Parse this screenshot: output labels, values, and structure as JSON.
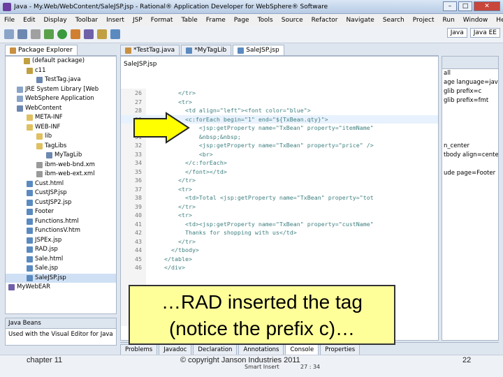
{
  "window": {
    "title": "Java - My.Web/WebContent/SaleJSP.jsp - Rational® Application Developer for WebSphere® Software"
  },
  "menu": [
    "File",
    "Edit",
    "Display",
    "Toolbar",
    "Insert",
    "JSP",
    "Format",
    "Table",
    "Frame",
    "Page",
    "Tools",
    "Source",
    "Refactor",
    "Navigate",
    "Search",
    "Project",
    "Run",
    "Window",
    "Help"
  ],
  "perspective": {
    "java": "Java",
    "javaee": "Java EE"
  },
  "explorer": {
    "tab": "Package Explorer",
    "items": [
      "(default package)",
      "c11",
      "TestTag.java",
      "JRE System Library [Web",
      "WebSphere Application",
      "WebContent",
      "META-INF",
      "WEB-INF",
      "lib",
      "TagLibs",
      "MyTagLib",
      "ibm-web-bnd.xm",
      "ibm-web-ext.xml",
      "Cust.html",
      "CustJSP.jsp",
      "CustJSP2.jsp",
      "Footer",
      "Functions.html",
      "FunctionsV.htm",
      "JSPEx.jsp",
      "RAD.jsp",
      "Sale.html",
      "Sale.jsp",
      "SaleJSP.jsp",
      "MyWebEAR"
    ]
  },
  "editor": {
    "tabs": [
      "*TestTag.java",
      "*MyTagLib",
      "SaleJSP.jsp"
    ],
    "crumb": "SaleJSP.jsp",
    "lines": [
      {
        "n": "26",
        "c": "        </tr>"
      },
      {
        "n": "27",
        "c": "        <tr>"
      },
      {
        "n": "28",
        "c": "          <td align=\"left\"><font color=\"blue\">"
      },
      {
        "n": "29",
        "c": "          <c:forEach begin=\"1\" end=\"${TxBean.qty}\">"
      },
      {
        "n": "30",
        "c": "              <jsp:getProperty name=\"TxBean\" property=\"itemName\""
      },
      {
        "n": "31",
        "c": "              &nbsp;&nbsp;"
      },
      {
        "n": "32",
        "c": "              <jsp:getProperty name=\"TxBean\" property=\"price\" />"
      },
      {
        "n": "33",
        "c": "              <br>"
      },
      {
        "n": "34",
        "c": "          </c:forEach>"
      },
      {
        "n": "35",
        "c": "          </font></td>"
      },
      {
        "n": "36",
        "c": "        </tr>"
      },
      {
        "n": "37",
        "c": "        <tr>"
      },
      {
        "n": "38",
        "c": "          <td>Total <jsp:getProperty name=\"TxBean\" property=\"tot"
      },
      {
        "n": "39",
        "c": "        </tr>"
      },
      {
        "n": "40",
        "c": "        <tr>"
      },
      {
        "n": "41",
        "c": "          <td><jsp:getProperty name=\"TxBean\" property=\"custName\""
      },
      {
        "n": "42",
        "c": "          Thanks for shopping with us</td>"
      },
      {
        "n": "43",
        "c": "        </tr>"
      },
      {
        "n": "44",
        "c": "      </tbody>"
      },
      {
        "n": "45",
        "c": "    </table>"
      },
      {
        "n": "46",
        "c": "    </div>"
      }
    ]
  },
  "outline": [
    "all",
    "age language=java",
    "glib prefix=c",
    "glib prefix=fmt",
    "",
    "",
    "",
    "",
    "n_center",
    "tbody align=cente",
    "",
    "ude page=Footer"
  ],
  "beans": {
    "tab": "Java Beans",
    "text": "Used with the Visual Editor for Java"
  },
  "bottom_tabs": [
    "Problems",
    "Javadoc",
    "Declaration",
    "Annotations",
    "Console",
    "Properties"
  ],
  "status": {
    "mode": "Smart Insert",
    "pos": "27 : 34"
  },
  "callout": {
    "line1": "…RAD inserted the tag",
    "line2": "(notice the prefix c)…"
  },
  "footer": {
    "chapter": "chapter 11",
    "copyright": "© copyright Janson Industries 2011",
    "page": "22"
  },
  "colors": {
    "callout_bg": "#ffff9a",
    "arrow": "#ffff00",
    "tag": "#3f7f7f",
    "attr": "#7f007f",
    "string": "#2a00ff"
  }
}
